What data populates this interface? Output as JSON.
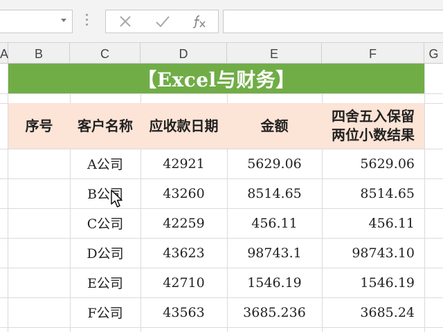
{
  "columns": [
    "A",
    "B",
    "C",
    "D",
    "E",
    "F",
    "G"
  ],
  "title": "【Excel与财务】",
  "headers": {
    "b": "序号",
    "c": "客户名称",
    "d": "应收款日期",
    "e": "金额",
    "f_line1": "四舍五入保留",
    "f_line2": "两位小数结果"
  },
  "rows": [
    {
      "name": "A公司",
      "date": "42921",
      "amount": "5629.06",
      "rounded": "5629.06"
    },
    {
      "name": "B公司",
      "date": "43260",
      "amount": "8514.65",
      "rounded": "8514.65"
    },
    {
      "name": "C公司",
      "date": "42259",
      "amount": "456.11",
      "rounded": "456.11"
    },
    {
      "name": "D公司",
      "date": "43623",
      "amount": "98743.1",
      "rounded": "98743.10"
    },
    {
      "name": "E公司",
      "date": "42710",
      "amount": "1546.19",
      "rounded": "1546.19"
    },
    {
      "name": "F公司",
      "date": "43563",
      "amount": "3685.236",
      "rounded": "3685.24"
    }
  ],
  "icons": {
    "cancel": "close-icon",
    "enter": "check-icon",
    "function": "fx-icon",
    "cursor": "mouse-pointer-icon"
  },
  "colors": {
    "title_band": "#70ad47",
    "header_band": "#fce4d6"
  }
}
